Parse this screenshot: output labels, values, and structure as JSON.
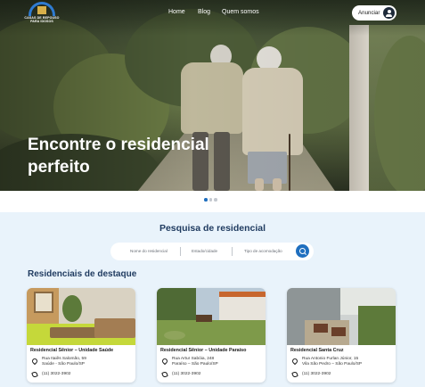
{
  "brand": {
    "logo_text": "CASAS DE REPOUSO PARA IDOSOS"
  },
  "nav": {
    "links": [
      "Home",
      "Blog",
      "Quem somos"
    ],
    "cta_label": "Anunciar"
  },
  "hero": {
    "title": "Encontre o residencial perfeito",
    "slides": 3,
    "active_slide": 1
  },
  "search": {
    "title": "Pesquisa de residencial",
    "fields": [
      "Nome do residencial",
      "Estado/cidade",
      "Tipo de acomodação"
    ]
  },
  "featured": {
    "title": "Residenciais de destaque",
    "cards": [
      {
        "name": "Residencial Sênior – Unidade Saúde",
        "address_line1": "Rua Itaiês Salomão, 59",
        "address_line2": "Saúde - São Paulo/SP",
        "phone": "(11) 3022-3902"
      },
      {
        "name": "Residencial Sênior – Unidade Paraíso",
        "address_line1": "Rua Artur Sabóia, 248",
        "address_line2": "Paraíso – São Paulo/SP",
        "phone": "(11) 3022-3902"
      },
      {
        "name": "Residencial Santa Cruz",
        "address_line1": "Rua Antonio Furlan Júnior, 15",
        "address_line2": "Vila São Pedro – São Paulo/SP",
        "phone": "(11) 3022-3902"
      }
    ]
  },
  "colors": {
    "accent": "#1f6fbf",
    "heading": "#1e3a5f",
    "section_bg": "#e9f3fb"
  }
}
